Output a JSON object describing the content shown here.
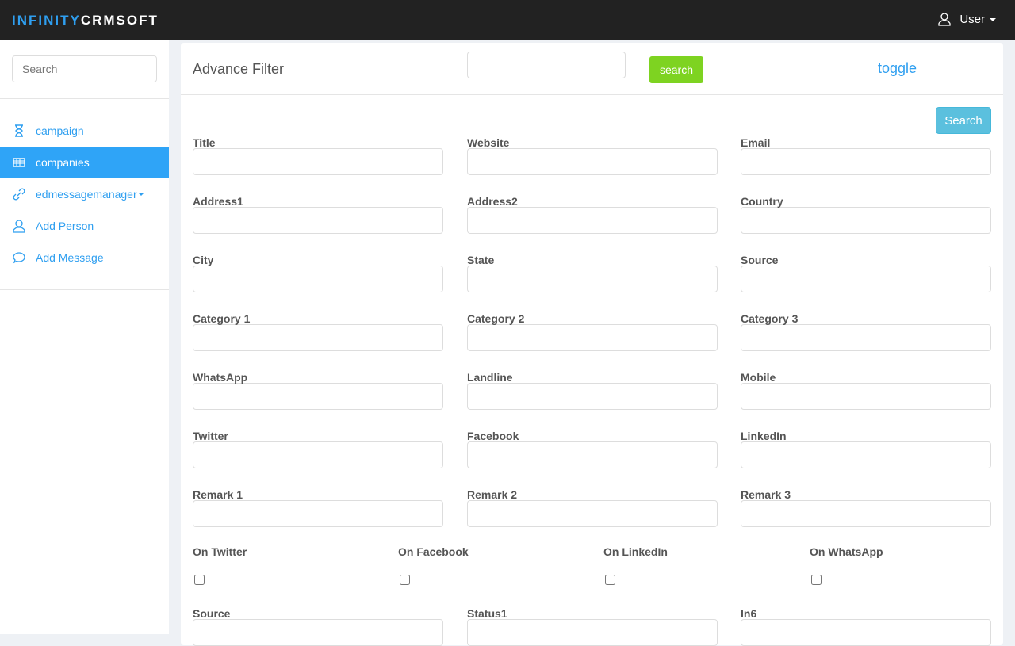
{
  "brand": {
    "part1": "INFINITY",
    "part2": "CRMSOFT"
  },
  "user_menu": {
    "label": "User"
  },
  "sidebar": {
    "search_placeholder": "Search",
    "items": [
      {
        "label": "campaign",
        "icon": "hourglass-icon",
        "active": false
      },
      {
        "label": "companies",
        "icon": "table-icon",
        "active": true
      },
      {
        "label": "edmessagemanager",
        "icon": "link-icon",
        "active": false,
        "dropdown": true
      },
      {
        "label": "Add Person",
        "icon": "user-icon",
        "active": false
      },
      {
        "label": "Add Message",
        "icon": "chat-bubble-icon",
        "active": false
      }
    ]
  },
  "panel": {
    "title": "Advance Filter",
    "search_value": "",
    "search_btn": "search",
    "toggle": "toggle",
    "search_btn2": "Search"
  },
  "fields": [
    "Title",
    "Website",
    "Email",
    "Address1",
    "Address2",
    "Country",
    "City",
    "State",
    "Source",
    "Category 1",
    "Category 2",
    "Category 3",
    "WhatsApp",
    "Landline",
    "Mobile",
    "Twitter",
    "Facebook",
    "LinkedIn",
    "Remark 1",
    "Remark 2",
    "Remark 3"
  ],
  "checkboxes": [
    {
      "label": "On Twitter",
      "checked": false
    },
    {
      "label": "On Facebook",
      "checked": false
    },
    {
      "label": "On LinkedIn",
      "checked": false
    },
    {
      "label": "On WhatsApp",
      "checked": false
    }
  ],
  "fields2": [
    "Source",
    "Status1",
    "In6"
  ],
  "colors": {
    "accent": "#2fa4f7",
    "green": "#7ed321",
    "info": "#5bc0de",
    "topbar": "#222222"
  }
}
